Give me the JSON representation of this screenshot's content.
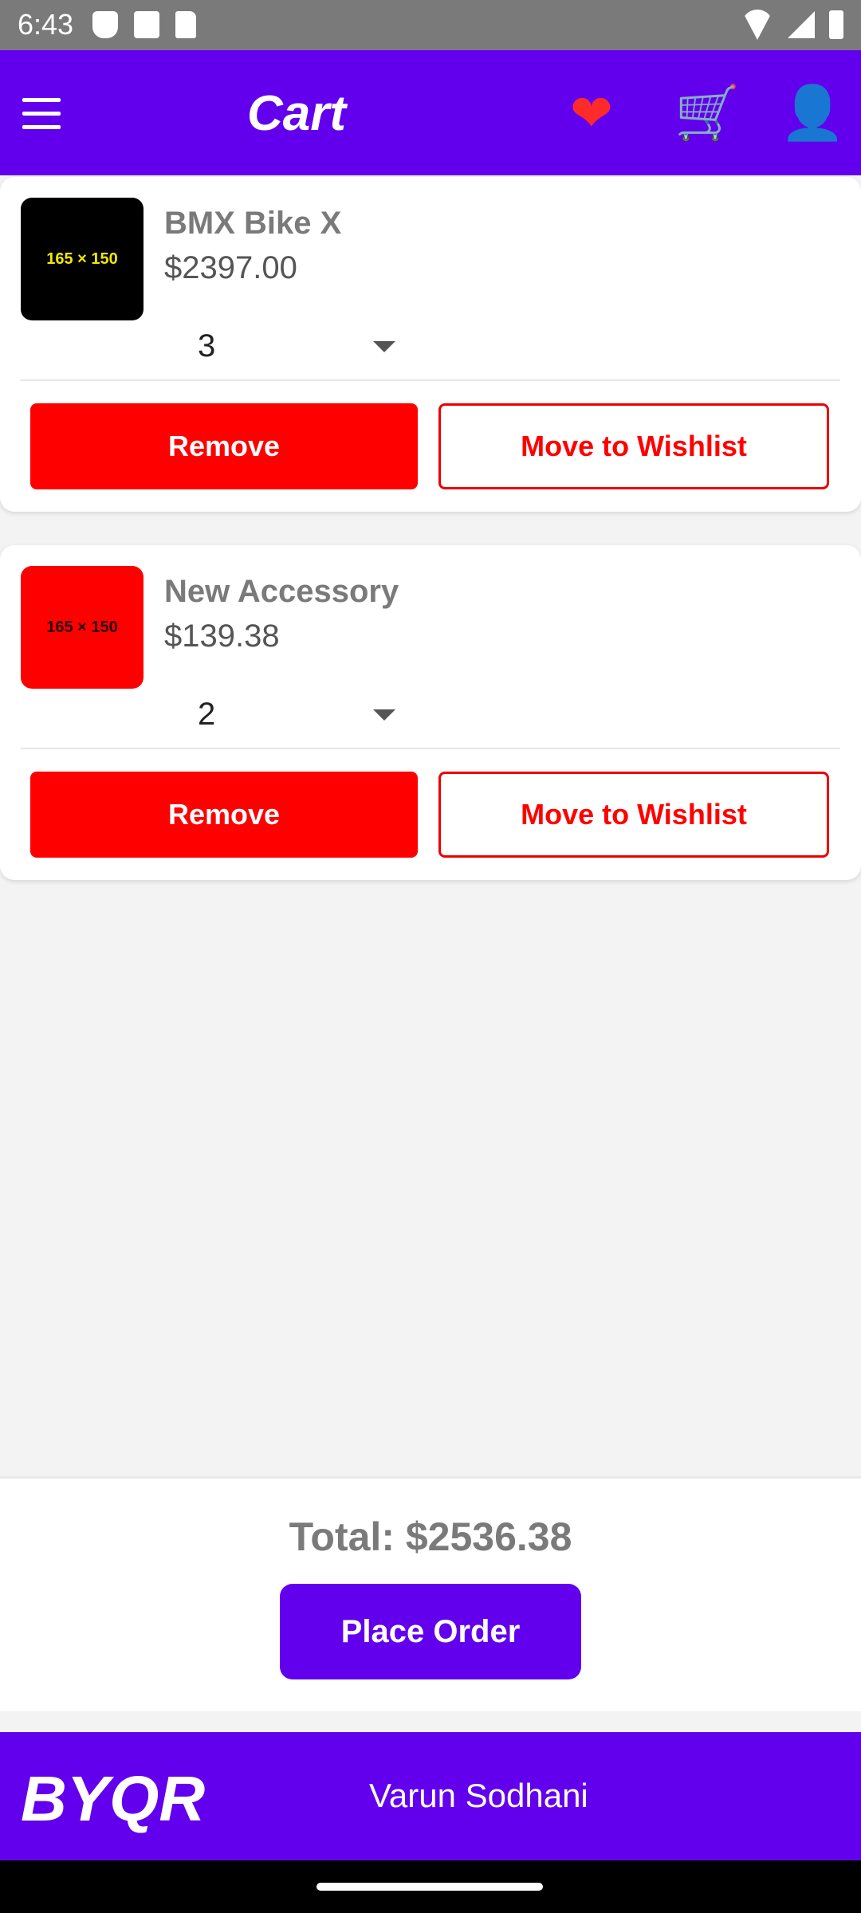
{
  "status_bar": {
    "time": "6:43"
  },
  "header": {
    "title": "Cart"
  },
  "cart": {
    "items": [
      {
        "name": "BMX Bike X",
        "price": "$2397.00",
        "quantity": "3",
        "thumb_text": "165 × 150",
        "thumb_bg": "#000000",
        "thumb_fg": "#f3e700",
        "remove_label": "Remove",
        "wishlist_label": "Move to Wishlist"
      },
      {
        "name": "New Accessory",
        "price": "$139.38",
        "quantity": "2",
        "thumb_text": "165 × 150",
        "thumb_bg": "#ff0000",
        "thumb_fg": "#2a0000",
        "remove_label": "Remove",
        "wishlist_label": "Move to Wishlist"
      }
    ]
  },
  "summary": {
    "total": "Total: $2536.38",
    "place_order_label": "Place Order"
  },
  "footer": {
    "logo": "BYQR",
    "user_name": "Varun Sodhani"
  },
  "colors": {
    "primary": "#6200ee",
    "danger": "#ff0000"
  }
}
